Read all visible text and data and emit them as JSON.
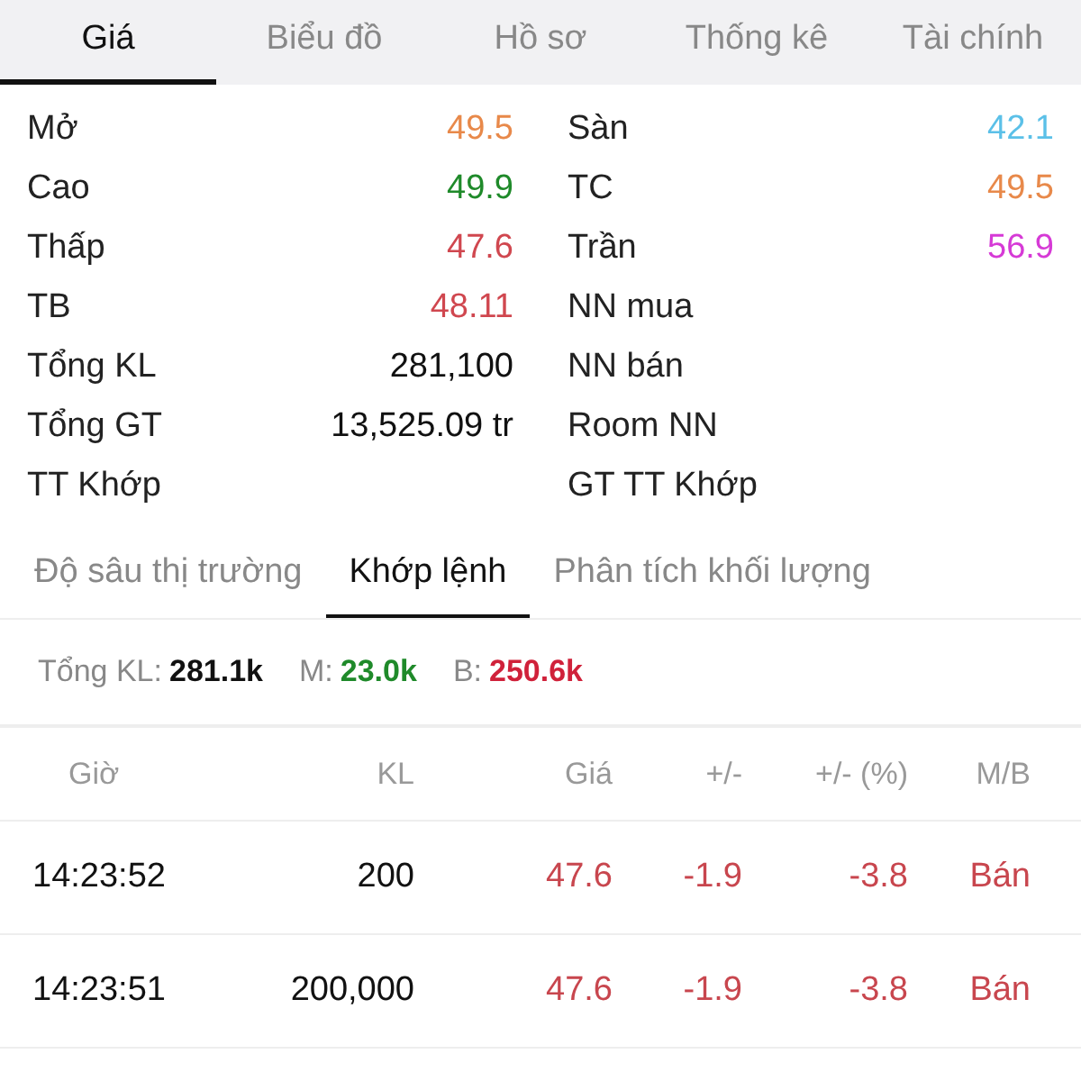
{
  "tabs": [
    {
      "label": "Giá",
      "selected": true
    },
    {
      "label": "Biểu đồ",
      "selected": false
    },
    {
      "label": "Hồ sơ",
      "selected": false
    },
    {
      "label": "Thống kê",
      "selected": false
    },
    {
      "label": "Tài chính",
      "selected": false
    }
  ],
  "stats_left": [
    {
      "label": "Mở",
      "value": "49.5",
      "color": "#e8894a"
    },
    {
      "label": "Cao",
      "value": "49.9",
      "color": "#1f8a2a"
    },
    {
      "label": "Thấp",
      "value": "47.6",
      "color": "#d0474f"
    },
    {
      "label": "TB",
      "value": "48.11",
      "color": "#d0474f"
    },
    {
      "label": "Tổng KL",
      "value": "281,100",
      "color": "#111111"
    },
    {
      "label": "Tổng GT",
      "value": "13,525.09 tr",
      "color": "#111111"
    },
    {
      "label": "TT Khớp"
    }
  ],
  "stats_right": [
    {
      "label": "Sàn",
      "value": "42.1",
      "color": "#5bc0e8"
    },
    {
      "label": "TC",
      "value": "49.5",
      "color": "#e8894a"
    },
    {
      "label": "Trần",
      "value": "56.9",
      "color": "#d63ad6"
    },
    {
      "label": "NN mua"
    },
    {
      "label": "NN bán"
    },
    {
      "label": "Room NN"
    },
    {
      "label": "GT TT Khớp"
    }
  ],
  "sub_tabs": [
    {
      "label": "Độ sâu thị trường",
      "selected": false
    },
    {
      "label": "Khớp lệnh",
      "selected": true
    },
    {
      "label": "Phân tích khối lượng",
      "selected": false
    }
  ],
  "summary": [
    {
      "label": "Tổng KL:",
      "value": "281.1k",
      "color": "#111111"
    },
    {
      "label": "M:",
      "value": "23.0k",
      "color": "#1f8a2a"
    },
    {
      "label": "B:",
      "value": "250.6k",
      "color": "#d0213a"
    }
  ],
  "table": {
    "columns": [
      "Giờ",
      "KL",
      "Giá",
      "+/-",
      "+/- (%)",
      "M/B"
    ],
    "rows": [
      {
        "cells": [
          "14:23:52",
          "200",
          "47.6",
          "-1.9",
          "-3.8",
          "Bán"
        ],
        "color": "#c8464e"
      },
      {
        "cells": [
          "14:23:51",
          "200,000",
          "47.6",
          "-1.9",
          "-3.8",
          "Bán"
        ],
        "color": "#c8464e"
      }
    ]
  }
}
